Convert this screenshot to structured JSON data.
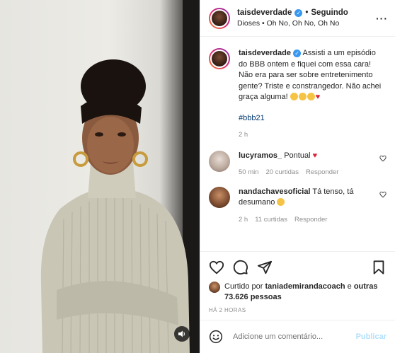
{
  "post": {
    "author": "taisdeverdade",
    "follow_status": "Seguindo",
    "audio": "Dioses • Oh No, Oh No, Oh No",
    "caption": "Assisti a um episódio do BBB ontem e fiquei com essa cara! Não era para ser sobre entretenimento gente? Triste e constrangedor. Não achei graça alguma!",
    "hashtag": "#bbb21",
    "caption_time": "2 h"
  },
  "comments": [
    {
      "user": "lucyramos_",
      "text": "Pontual",
      "time": "50 min",
      "likes": "20 curtidas",
      "reply": "Responder"
    },
    {
      "user": "nandachavesoficial",
      "text": "Tá tenso, tá desumano",
      "time": "2 h",
      "likes": "11 curtidas",
      "reply": "Responder"
    }
  ],
  "likes": {
    "prefix": "Curtido por",
    "user": "taniademirandacoach",
    "middle": "e",
    "others": "outras 73.626 pessoas"
  },
  "posted_ago": "HÁ 2 HORAS",
  "composer": {
    "placeholder": "Adicione um comentário...",
    "publish_label": "Publicar"
  },
  "colors": {
    "link": "#00376b",
    "verified": "#3897f0",
    "publish_disabled": "#b2dffc",
    "heart": "#d6243c"
  }
}
